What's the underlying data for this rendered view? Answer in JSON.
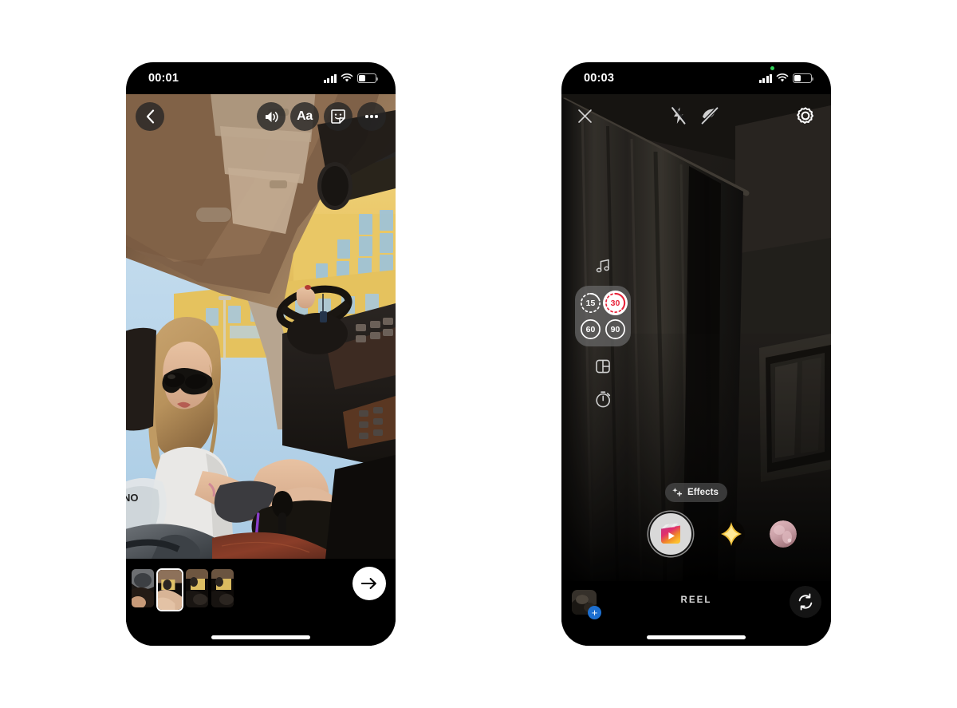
{
  "left_phone": {
    "status_bar": {
      "time": "00:01",
      "signal_icon": "signal-bars-icon",
      "wifi_icon": "wifi-icon",
      "battery_icon": "battery-icon",
      "battery_level_pct": 38
    },
    "toolbar": {
      "back_icon": "chevron-left-icon",
      "sound_icon": "speaker-volume-icon",
      "text_label": "Aa",
      "sticker_icon": "sticker-smiley-icon",
      "more_icon": "more-options-icon"
    },
    "media": {
      "description": "Photo taken inside a car: woman in sunglasses in passenger seat, yellow building outside windshield"
    },
    "filmstrip": {
      "selected_index": 1,
      "thumbnails": [
        {
          "name": "clip-1"
        },
        {
          "name": "clip-2"
        },
        {
          "name": "clip-3"
        },
        {
          "name": "clip-4"
        }
      ]
    },
    "next_button": {
      "icon": "arrow-right-icon",
      "accent": "#ffffff"
    },
    "home_indicator": "home-indicator"
  },
  "right_phone": {
    "status_bar": {
      "time": "00:03",
      "signal_icon": "signal-bars-icon",
      "wifi_icon": "wifi-icon",
      "battery_icon": "battery-icon",
      "battery_level_pct": 38,
      "recording_dot_color": "#30d158"
    },
    "toolbar": {
      "close_icon": "close-x-icon",
      "flash_off_icon": "flash-off-icon",
      "filter_off_icon": "filter-off-icon",
      "settings_icon": "gear-settings-icon"
    },
    "side_tools": {
      "music_icon": "music-note-icon",
      "layout_icon": "layout-grid-icon",
      "timer_icon": "timer-stopwatch-icon"
    },
    "duration_selector": {
      "selected": "30",
      "selected_color": "#e8253b",
      "options": [
        {
          "value": "15",
          "style": "dashed"
        },
        {
          "value": "30",
          "style": "active"
        },
        {
          "value": "60",
          "style": "solid"
        },
        {
          "value": "90",
          "style": "solid"
        }
      ]
    },
    "effects": {
      "pill_label": "Effects",
      "pill_icon": "sparkle-plus-icon",
      "record_icon": "reels-clapperboard-icon",
      "fx_items": [
        {
          "name": "effect-sparkle-gold"
        },
        {
          "name": "effect-pink-portrait"
        }
      ]
    },
    "bottom_bar": {
      "gallery_icon": "gallery-thumbnail",
      "gallery_add_badge": "+",
      "gallery_badge_color": "#1d6fd0",
      "mode_label": "REEL",
      "flip_camera_icon": "flip-camera-icon"
    },
    "home_indicator": "home-indicator"
  }
}
